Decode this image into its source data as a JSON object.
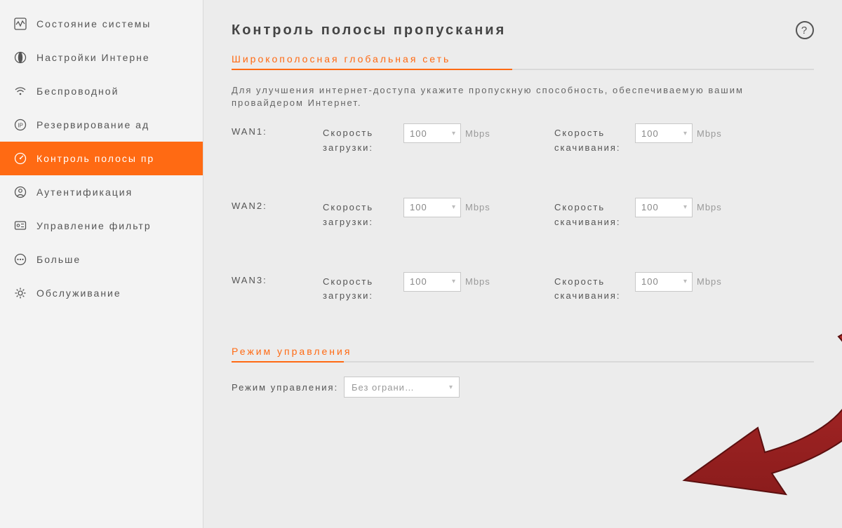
{
  "sidebar": {
    "items": [
      {
        "label": "Состояние системы"
      },
      {
        "label": "Настройки Интерне"
      },
      {
        "label": "Беспроводной"
      },
      {
        "label": "Резервирование ад"
      },
      {
        "label": "Контроль полосы пр"
      },
      {
        "label": "Аутентификация"
      },
      {
        "label": "Управление фильтр"
      },
      {
        "label": "Больше"
      },
      {
        "label": "Обслуживание"
      }
    ]
  },
  "page": {
    "title": "Контроль полосы пропускания",
    "help": "?"
  },
  "section1": {
    "title": "Широкополосная глобальная сеть",
    "desc": "Для улучшения интернет-доступа укажите пропускную способность, обеспечиваемую вашим провайдером Интернет.",
    "unit": "Mbps",
    "upload_label": "Скорость загрузки:",
    "download_label": "Скорость скачивания:",
    "wans": [
      {
        "name": "WAN1:",
        "upload": "100",
        "download": "100"
      },
      {
        "name": "WAN2:",
        "upload": "100",
        "download": "100"
      },
      {
        "name": "WAN3:",
        "upload": "100",
        "download": "100"
      }
    ]
  },
  "section2": {
    "title": "Режим управления",
    "mode_label": "Режим управления:",
    "mode_value": "Без ограни…"
  }
}
